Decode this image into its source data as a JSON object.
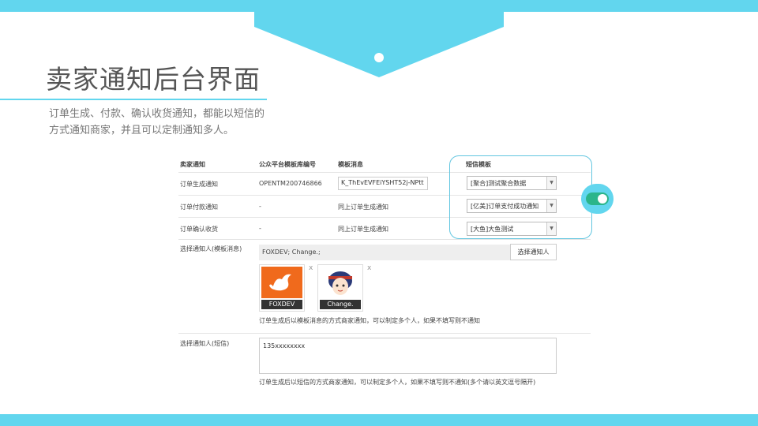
{
  "page": {
    "title": "卖家通知后台界面",
    "subtitle": "订单生成、付款、确认收货通知，都能以短信的方式通知商家，并且可以定制通知多人。"
  },
  "table": {
    "headers": [
      "卖家通知",
      "公众平台模板库编号",
      "模板消息",
      "短信模板"
    ],
    "rows": [
      {
        "name": "订单生成通知",
        "code": "OPENTM200746866",
        "template": "K_ThEvEVFEiYSHT52j-NPtt",
        "sms": "[聚合]测试聚合数据"
      },
      {
        "name": "订单付款通知",
        "code": "-",
        "template": "同上订单生成通知",
        "sms": "[亿美]订单支付成功通知"
      },
      {
        "name": "订单确认收货",
        "code": "-",
        "template": "同上订单生成通知",
        "sms": "[大鱼]大鱼测试"
      }
    ]
  },
  "toggle": {
    "on": true
  },
  "notify_template": {
    "label": "选择通知人(模板消息)",
    "value": "FOXDEV; Change.;",
    "button": "选择通知人",
    "people": [
      {
        "name": "FOXDEV",
        "remove": "x"
      },
      {
        "name": "Change.",
        "remove": "x"
      }
    ],
    "hint": "订单生成后以模板消息的方式商家通知，可以制定多个人，如果不填写则不通知"
  },
  "notify_sms": {
    "label": "选择通知人(短信)",
    "value": "135xxxxxxxx",
    "hint": "订单生成后以短信的方式商家通知，可以制定多个人，如果不填写则不通知(多个请以英文逗号隔开)"
  },
  "colors": {
    "accent": "#62d6ee",
    "toggle": "#2bb58a",
    "fox": "#f06a1c"
  }
}
